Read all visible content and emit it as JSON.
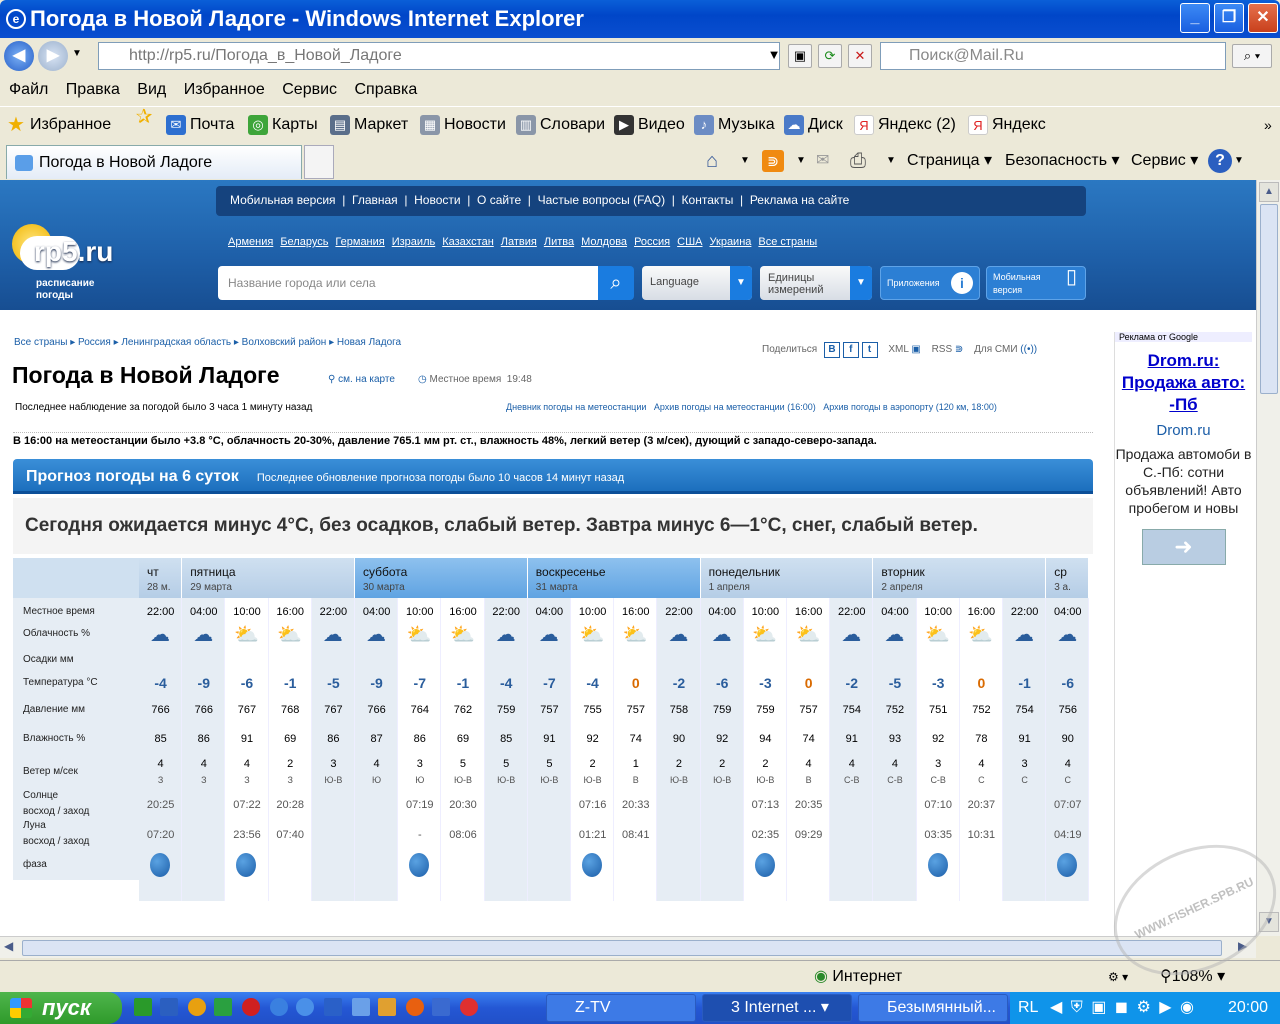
{
  "window": {
    "title": "Погода в Новой Ладоге - Windows Internet Explorer",
    "url": "http://rp5.ru/Погода_в_Новой_Ладоге",
    "search_placeholder": "Поиск@Mail.Ru"
  },
  "menu": [
    "Файл",
    "Правка",
    "Вид",
    "Избранное",
    "Сервис",
    "Справка"
  ],
  "favorites": {
    "label": "Избранное",
    "items": [
      "Почта",
      "Карты",
      "Маркет",
      "Новости",
      "Словари",
      "Видео",
      "Музыка",
      "Диск",
      "Яндекс (2)",
      "Яндекс"
    ]
  },
  "tab": {
    "title": "Погода в Новой Ладоге"
  },
  "commands": [
    "Страница",
    "Безопасность",
    "Сервис"
  ],
  "site": {
    "topnav": "Мобильная версия  |  Главная  |  Новости  |  О сайте  |  Частые вопросы (FAQ)  |  Контакты  |  Реклама на сайте",
    "countries": [
      "Армения",
      "Беларусь",
      "Германия",
      "Израиль",
      "Казахстан",
      "Латвия",
      "Литва",
      "Молдова",
      "Россия",
      "США",
      "Украина",
      "Все страны"
    ],
    "logo_text": "rp5.ru",
    "logo_sub1": "расписание",
    "logo_sub2": "погоды",
    "city_placeholder": "Название города или села",
    "language": "Language",
    "units_l1": "Единицы",
    "units_l2": "измерений",
    "apps": "Приложения",
    "mobile_l1": "Мобильная",
    "mobile_l2": "версия"
  },
  "breadcrumb": "Все страны ▸ Россия ▸ Ленинградская область ▸ Волховский район ▸ Новая Ладога",
  "share": {
    "share": "Поделиться",
    "xml": "XML",
    "rss": "RSS",
    "media": "Для СМИ"
  },
  "page": {
    "title": "Погода в Новой Ладоге",
    "map_link": "см. на карте",
    "local_time": "Местное время  19:48",
    "last_obs": "Последнее наблюдение за погодой было 3 часа 1 минуту назад",
    "archives": "Дневник погоды на метеостанции   Архив погоды на метеостанции (16:00)   Архив погоды в аэропорту (120 км, 18:00)",
    "obs_detail": "В 16:00 на метеостанции было +3.8 °С, облачность 20-30%, давление 765.1 мм рт. ст., влажность 48%, легкий ветер (3 м/сек), дующий с западо-северо-запада.",
    "forecast_title": "Прогноз погоды на 6 суток",
    "forecast_update": "Последнее обновление прогноза погоды было 10 часов 14 минут назад",
    "summary": "Сегодня ожидается минус 4°С, без осадков, слабый ветер. Завтра минус 6—1°С, снег, слабый ветер."
  },
  "grid": {
    "row_labels": [
      "Местное время",
      "Облачность %",
      "Осадки мм",
      "Температура °С",
      "Давление мм",
      "Влажность %",
      "Ветер м/сек",
      "Солнце",
      "восход / заход",
      "Луна",
      "восход / заход",
      "фаза"
    ],
    "days": [
      {
        "name": "чт",
        "date": "28 м.",
        "highlight": false,
        "cols": 1
      },
      {
        "name": "пятница",
        "date": "29 марта",
        "highlight": false,
        "cols": 4
      },
      {
        "name": "суббота",
        "date": "30 марта",
        "highlight": true,
        "cols": 4
      },
      {
        "name": "воскресенье",
        "date": "31 марта",
        "highlight": true,
        "cols": 4
      },
      {
        "name": "понедельник",
        "date": "1 апреля",
        "highlight": false,
        "cols": 4
      },
      {
        "name": "вторник",
        "date": "2 апреля",
        "highlight": false,
        "cols": 4
      },
      {
        "name": "ср",
        "date": "3 а.",
        "highlight": false,
        "cols": 1
      }
    ],
    "times": [
      "22:00",
      "04:00",
      "10:00",
      "16:00",
      "22:00",
      "04:00",
      "10:00",
      "16:00",
      "22:00",
      "04:00",
      "10:00",
      "16:00",
      "22:00",
      "04:00",
      "10:00",
      "16:00",
      "22:00",
      "04:00",
      "10:00",
      "16:00",
      "22:00",
      "04:00"
    ],
    "temps": [
      "-4",
      "-9",
      "-6",
      "-1",
      "-5",
      "-9",
      "-7",
      "-1",
      "-4",
      "-7",
      "-4",
      "0",
      "-2",
      "-6",
      "-3",
      "0",
      "-2",
      "-5",
      "-3",
      "0",
      "-1",
      "-6"
    ],
    "pressure": [
      "766",
      "766",
      "767",
      "768",
      "767",
      "766",
      "764",
      "762",
      "759",
      "757",
      "755",
      "757",
      "758",
      "759",
      "759",
      "757",
      "754",
      "752",
      "751",
      "752",
      "754",
      "756"
    ],
    "humidity": [
      "85",
      "86",
      "91",
      "69",
      "86",
      "87",
      "86",
      "69",
      "85",
      "91",
      "92",
      "74",
      "90",
      "92",
      "94",
      "74",
      "91",
      "93",
      "92",
      "78",
      "91",
      "90"
    ],
    "wind_speed": [
      "4",
      "4",
      "4",
      "2",
      "3",
      "4",
      "3",
      "5",
      "5",
      "5",
      "2",
      "1",
      "2",
      "2",
      "2",
      "4",
      "4",
      "4",
      "3",
      "4",
      "3",
      "4"
    ],
    "wind_dir": [
      "З",
      "З",
      "З",
      "З",
      "Ю-В",
      "Ю",
      "Ю",
      "Ю-В",
      "Ю-В",
      "Ю-В",
      "Ю-В",
      "В",
      "Ю-В",
      "Ю-В",
      "Ю-В",
      "В",
      "С-В",
      "С-В",
      "С-В",
      "С",
      "С",
      "С"
    ],
    "sun": [
      {
        "rise": "20:25",
        "set": ""
      },
      {
        "rise": "07:22",
        "set": "20:28"
      },
      {
        "rise": "07:19",
        "set": "20:30"
      },
      {
        "rise": "07:16",
        "set": "20:33"
      },
      {
        "rise": "07:13",
        "set": "20:35"
      },
      {
        "rise": "07:10",
        "set": "20:37"
      },
      {
        "rise": "07:07",
        "set": ""
      }
    ],
    "moon": [
      {
        "rise": "07:20",
        "set": ""
      },
      {
        "rise": "23:56",
        "set": "07:40"
      },
      {
        "rise": "-",
        "set": "08:06"
      },
      {
        "rise": "01:21",
        "set": "08:41"
      },
      {
        "rise": "02:35",
        "set": "09:29"
      },
      {
        "rise": "03:35",
        "set": "10:31"
      },
      {
        "rise": "04:19",
        "set": ""
      }
    ]
  },
  "ad": {
    "header": "Реклама от Google",
    "title": "Drom.ru: Продажа авто: -Пб",
    "domain": "Drom.ru",
    "body": "Продажа автомоби в С.-Пб: сотни объявлений! Авто пробегом и новы"
  },
  "status": {
    "zone": "Интернет",
    "zoom": "108%"
  },
  "taskbar": {
    "start": "пуск",
    "tasks": [
      "Z-TV",
      "3 Internet ...",
      "Безымянный..."
    ],
    "lang": "RL",
    "clock": "20:00"
  },
  "watermark": "WWW.FISHER.SPB.RU"
}
